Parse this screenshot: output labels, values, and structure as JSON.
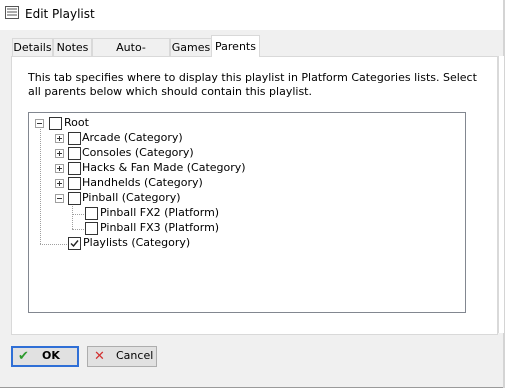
{
  "window": {
    "title": "Edit Playlist"
  },
  "tabs": [
    {
      "label": "Details"
    },
    {
      "label": "Notes"
    },
    {
      "label": "Auto-Populate"
    },
    {
      "label": "Games"
    },
    {
      "label": "Parents",
      "active": true
    }
  ],
  "parents_tab": {
    "description": "This tab specifies where to display this playlist in Platform Categories lists. Select all parents below which should contain this playlist.",
    "tree": [
      {
        "label": "Root",
        "checked": false,
        "expanded": true
      },
      {
        "label": "Arcade (Category)",
        "checked": false,
        "expanded": false
      },
      {
        "label": "Consoles (Category)",
        "checked": false,
        "expanded": false
      },
      {
        "label": "Hacks & Fan Made (Category)",
        "checked": false,
        "expanded": false
      },
      {
        "label": "Handhelds (Category)",
        "checked": false,
        "expanded": false
      },
      {
        "label": "Pinball (Category)",
        "checked": false,
        "expanded": true
      },
      {
        "label": "Pinball FX2 (Platform)",
        "checked": false
      },
      {
        "label": "Pinball FX3 (Platform)",
        "checked": false
      },
      {
        "label": "Playlists (Category)",
        "checked": true
      }
    ]
  },
  "buttons": {
    "ok": "OK",
    "cancel": "Cancel"
  },
  "icons": {
    "window": "playlist-window-icon",
    "ok": "checkmark-icon",
    "cancel": "x-icon"
  },
  "colors": {
    "accent": "#2f6fd6",
    "ok_icon": "#2e9a2e",
    "cancel_icon": "#d23030"
  }
}
